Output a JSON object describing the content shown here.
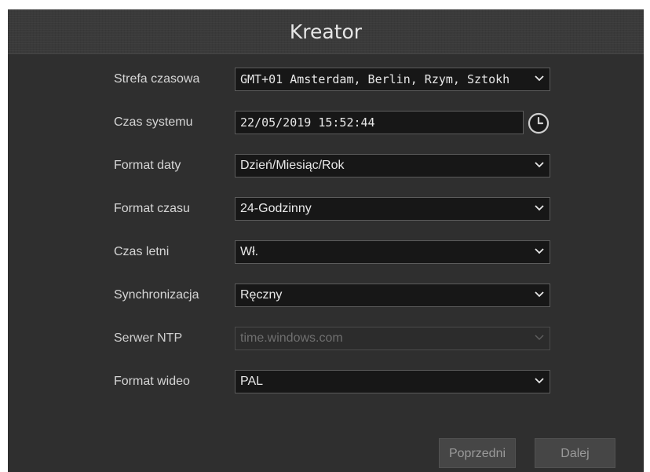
{
  "window": {
    "title": "Kreator"
  },
  "rows": [
    {
      "label": "Strefa czasowa",
      "value": "GMT+01 Amsterdam, Berlin, Rzym, Sztokh",
      "type": "select"
    },
    {
      "label": "Czas systemu",
      "value": "22/05/2019 15:52:44",
      "type": "datetime"
    },
    {
      "label": "Format daty",
      "value": "Dzień/Miesiąc/Rok",
      "type": "select"
    },
    {
      "label": "Format czasu",
      "value": "24-Godzinny",
      "type": "select"
    },
    {
      "label": "Czas letni",
      "value": "Wł.",
      "type": "select"
    },
    {
      "label": "Synchronizacja",
      "value": "Ręczny",
      "type": "select"
    },
    {
      "label": "Serwer NTP",
      "value": "time.windows.com",
      "type": "select",
      "disabled": true
    },
    {
      "label": "Format wideo",
      "value": "PAL",
      "type": "select"
    }
  ],
  "buttons": {
    "previous": "Poprzedni",
    "next": "Dalej"
  },
  "icons": {
    "dropdown": "chevron-down-icon",
    "clock": "clock-icon"
  },
  "colors": {
    "background": "#2f2f2f",
    "field": "#171717",
    "border": "#5c5c5c",
    "text": "#d6d6d6"
  }
}
